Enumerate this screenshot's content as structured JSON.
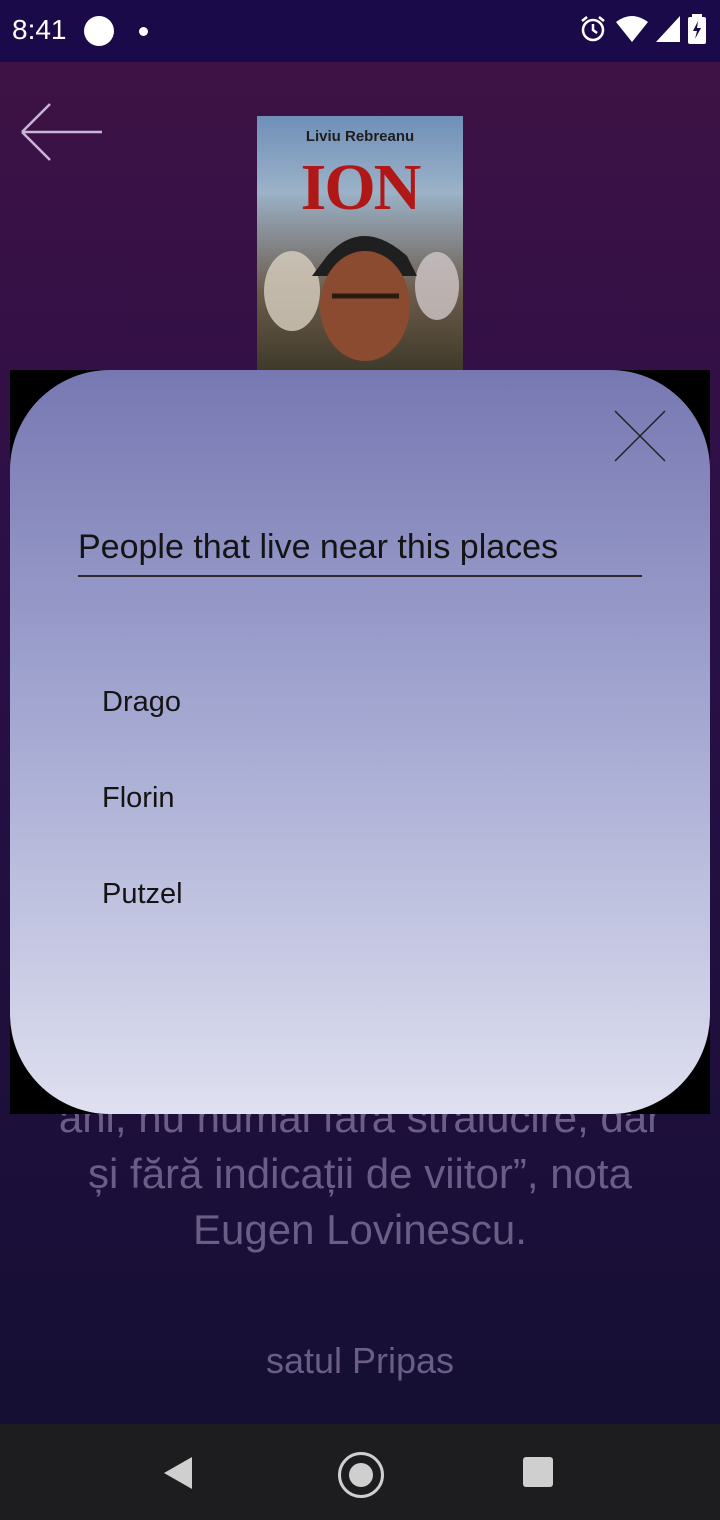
{
  "status_bar": {
    "time": "8:41",
    "icons": [
      "alarm-icon",
      "wifi-icon",
      "signal-icon",
      "battery-icon"
    ]
  },
  "book": {
    "author": "Liviu Rebreanu",
    "title": "ION"
  },
  "modal": {
    "title": "People that live near this places",
    "people": [
      "Drago",
      "Florin",
      "Putzel"
    ]
  },
  "background_text": {
    "line1": "ani, nu numai fără strălucire, dar",
    "line2": "și fără indicații de viitor”, nota",
    "line3": "Eugen Lovinescu.",
    "place": "satul Pripas"
  },
  "colors": {
    "status_bar": "#1b0a4a",
    "modal_top": "#7778b2",
    "modal_bottom": "#dfe0f0",
    "navbar": "#1d1d1f"
  }
}
